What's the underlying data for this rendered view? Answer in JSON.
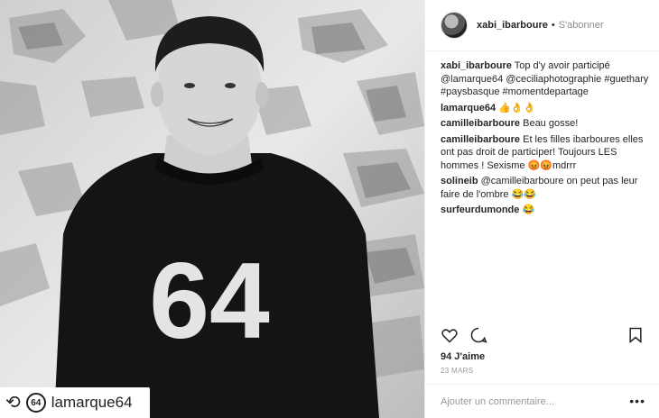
{
  "post": {
    "author": "xabi_ibarboure",
    "separator": "•",
    "follow_label": "S'abonner",
    "caption_author": "xabi_ibarboure",
    "caption_text": "Top d'y avoir participé @lamarque64 @ceciliaphotographie #guethary #paysbasque #momentdepartage"
  },
  "comments": [
    {
      "user": "lamarque64",
      "text": "👍👌👌"
    },
    {
      "user": "camilleibarboure",
      "text": "Beau gosse!"
    },
    {
      "user": "camilleibarboure",
      "text": "Et les filles ibarboures elles ont pas droit de participer! Toujours LES hommes ! Sexisme 😡😡mdrrr"
    },
    {
      "user": "solineib",
      "text": "@camilleibarboure on peut pas leur faire de l'ombre 😂😂"
    },
    {
      "user": "surfeurdumonde",
      "text": "😂"
    }
  ],
  "photo": {
    "sweater_number": "64",
    "repost_handle": "lamarque64",
    "repost_badge": "64",
    "repost_icon": "repost-icon"
  },
  "actions": {
    "like_icon": "heart-icon",
    "comment_icon": "comment-icon",
    "save_icon": "bookmark-icon"
  },
  "likes_text": "94 J'aime",
  "date_text": "23 MARS",
  "add_comment_placeholder": "Ajouter un commentaire...",
  "more_label": "•••"
}
